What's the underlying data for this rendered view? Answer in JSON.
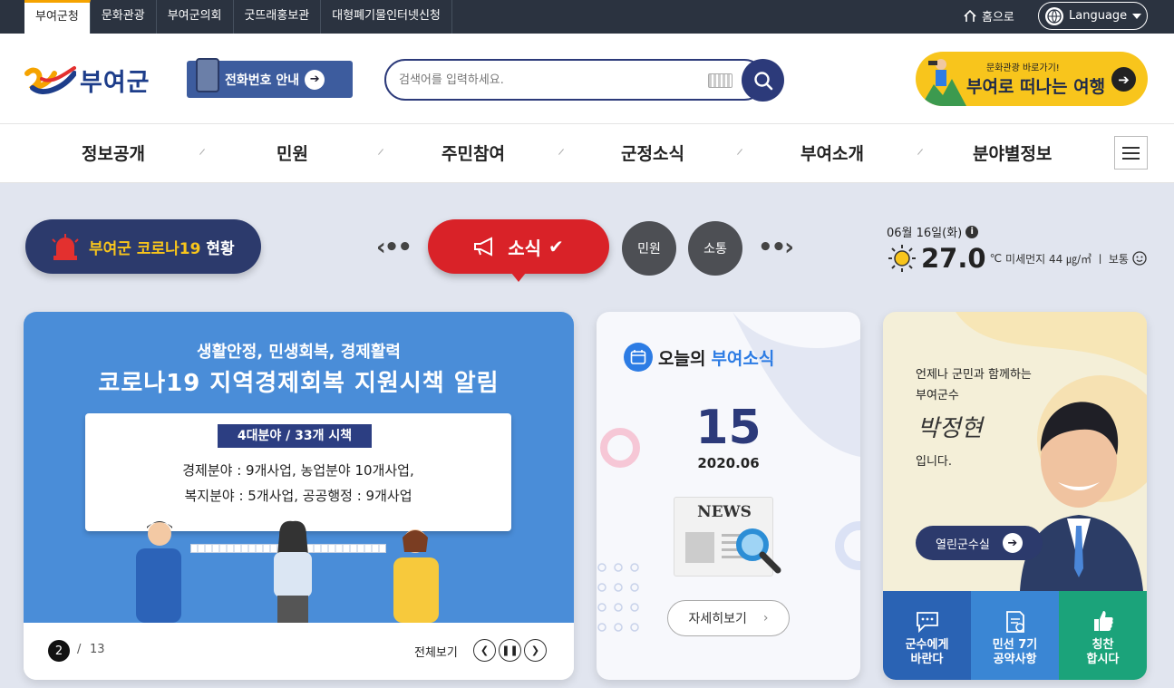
{
  "topbar": {
    "tabs": [
      "부여군청",
      "문화관광",
      "부여군의회",
      "굿뜨래홍보관",
      "대형폐기물인터넷신청"
    ],
    "home_label": "홈으로",
    "language_label": "Language"
  },
  "header": {
    "logo_text": "부여군",
    "phone_guide_label": "전화번호 안내",
    "search_placeholder": "검색어를 입력하세요.",
    "banner_small": "문화관광 바로가기!",
    "banner_big": "부여로 떠나는 여행"
  },
  "gnb": {
    "items": [
      "정보공개",
      "민원",
      "주민참여",
      "군정소식",
      "부여소개",
      "분야별정보"
    ]
  },
  "notice": {
    "covid_prefix": "부여군 코로나19",
    "covid_suffix": "현황",
    "tab_news": "소식",
    "tab_civil": "민원",
    "tab_comm": "소통"
  },
  "weather": {
    "date": "06월 16일(화)",
    "temp": "27.0",
    "unit": "℃",
    "dust": "미세먼지 44 ㎍/㎥ ㅣ 보통"
  },
  "slide": {
    "title1": "생활안정, 민생회복, 경제활력",
    "title2": "코로나19 지역경제회복 지원시책 알림",
    "badge": "4대분야 / 33개 시책",
    "line1": "경제분야 : 9개사업, 농업분야 10개사업,",
    "line2": "복지분야 : 5개사업, 공공행정 : 9개사업",
    "current_page": "2",
    "separator": "/",
    "total_pages": "13",
    "view_all": "전체보기"
  },
  "today": {
    "title_prefix": "오늘의",
    "title_highlight": "부여소식",
    "day": "15",
    "year_month": "2020.06",
    "news_word": "NEWS",
    "detail_label": "자세히보기"
  },
  "mayor": {
    "line1": "언제나 군민과 함께하는",
    "line2": "부여군수",
    "name": "박정현",
    "line3": "입니다.",
    "office_label": "열린군수실",
    "tiles": [
      {
        "label": "군수에게\n바란다",
        "color": "#2a63b4"
      },
      {
        "label": "민선 7기\n공약사항",
        "color": "#3a86d4"
      },
      {
        "label": "칭찬\n합시다",
        "color": "#1ba37a"
      }
    ]
  },
  "colors": {
    "navy": "#2c3a7a",
    "red": "#d92228",
    "yellow": "#f8c51c",
    "bg": "#e1e5ef"
  }
}
